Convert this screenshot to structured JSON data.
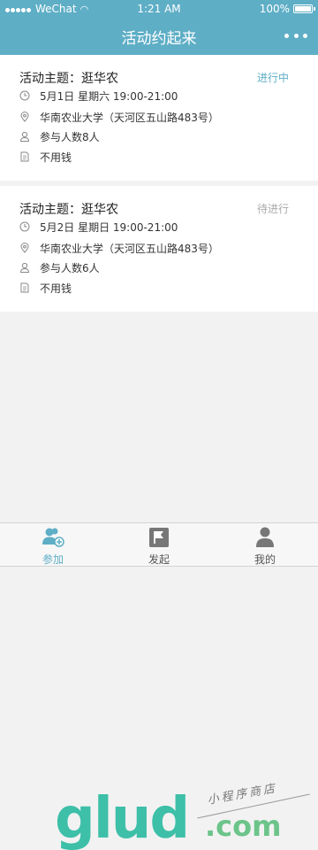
{
  "status_bar": {
    "carrier": "WeChat",
    "time": "1:21 AM",
    "battery": "100%"
  },
  "nav": {
    "title": "活动约起来"
  },
  "activities": [
    {
      "title": "活动主题：逛华农",
      "status": "进行中",
      "time": "5月1日 星期六 19:00-21:00",
      "location": "华南农业大学（天河区五山路483号）",
      "participants": "参与人数8人",
      "cost": "不用钱"
    },
    {
      "title": "活动主题：逛华农",
      "status": "待进行",
      "time": "5月2日 星期日 19:00-21:00",
      "location": "华南农业大学（天河区五山路483号）",
      "participants": "参与人数6人",
      "cost": "不用钱"
    }
  ],
  "tabs": [
    {
      "label": "参加",
      "icon": "group-add-icon",
      "active": true
    },
    {
      "label": "发起",
      "icon": "flag-icon",
      "active": false
    },
    {
      "label": "我的",
      "icon": "person-icon",
      "active": false
    }
  ],
  "watermark": {
    "logo": "glud",
    "tagline": "小程序商店",
    "domain": ".com"
  },
  "colors": {
    "accent": "#5eaec6",
    "pending": "#aaaaaa",
    "background": "#f2f2f2"
  }
}
